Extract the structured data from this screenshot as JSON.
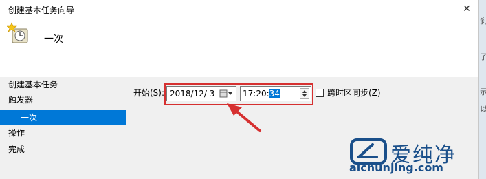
{
  "window": {
    "title": "创建基本任务向导",
    "close_icon": "✕"
  },
  "header": {
    "icon": "clock-star-icon",
    "title": "一次"
  },
  "sidebar": {
    "items": [
      {
        "label": "创建基本任务",
        "selected": false
      },
      {
        "label": "触发器",
        "selected": false
      },
      {
        "label": "一次",
        "selected": true
      },
      {
        "label": "操作",
        "selected": false
      },
      {
        "label": "完成",
        "selected": false
      }
    ]
  },
  "form": {
    "start_label": "开始(S):",
    "date_value": "2018/12/ 3",
    "time_prefix": "17:20:",
    "time_selected": "34",
    "timezone_sync_label": "跨时区同步(Z)",
    "timezone_sync_checked": false
  },
  "annotation": {
    "highlight_color": "#d63030"
  },
  "watermark": {
    "name": "爱纯净",
    "url": "aichunjing.com",
    "color": "#1a4f8a"
  },
  "right_edge": {
    "glyphs": [
      "刹",
      "了",
      "示",
      "以"
    ]
  },
  "colors": {
    "selection": "#0078d7",
    "dialog_bg": "#f0f0f0"
  }
}
